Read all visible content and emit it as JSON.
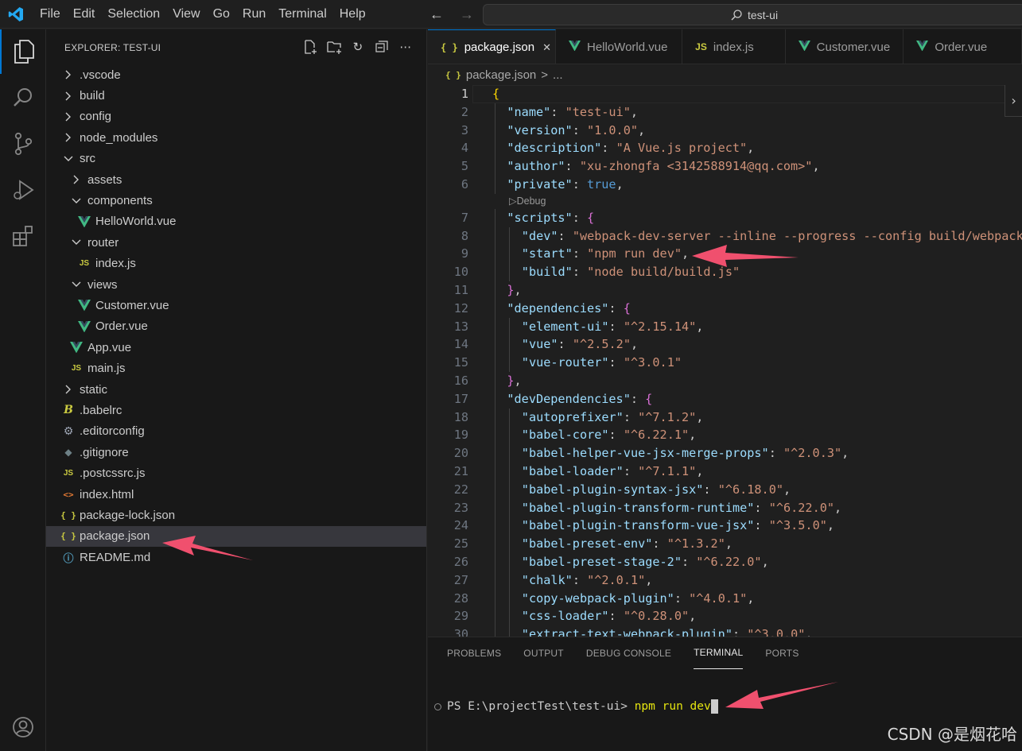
{
  "titlebar": {
    "menus": [
      "File",
      "Edit",
      "Selection",
      "View",
      "Go",
      "Run",
      "Terminal",
      "Help"
    ],
    "search_text": "test-ui"
  },
  "sidebar": {
    "title": "EXPLORER: TEST-UI",
    "items": [
      {
        "label": ".vscode",
        "type": "folder",
        "expanded": false,
        "depth": 0
      },
      {
        "label": "build",
        "type": "folder",
        "expanded": false,
        "depth": 0
      },
      {
        "label": "config",
        "type": "folder",
        "expanded": false,
        "depth": 0
      },
      {
        "label": "node_modules",
        "type": "folder",
        "expanded": false,
        "depth": 0
      },
      {
        "label": "src",
        "type": "folder",
        "expanded": true,
        "depth": 0
      },
      {
        "label": "assets",
        "type": "folder",
        "expanded": false,
        "depth": 1
      },
      {
        "label": "components",
        "type": "folder",
        "expanded": true,
        "depth": 1
      },
      {
        "label": "HelloWorld.vue",
        "type": "vue",
        "depth": 2
      },
      {
        "label": "router",
        "type": "folder",
        "expanded": true,
        "depth": 1
      },
      {
        "label": "index.js",
        "type": "js",
        "depth": 2
      },
      {
        "label": "views",
        "type": "folder",
        "expanded": true,
        "depth": 1
      },
      {
        "label": "Customer.vue",
        "type": "vue",
        "depth": 2
      },
      {
        "label": "Order.vue",
        "type": "vue",
        "depth": 2
      },
      {
        "label": "App.vue",
        "type": "vue",
        "depth": 1
      },
      {
        "label": "main.js",
        "type": "js",
        "depth": 1
      },
      {
        "label": "static",
        "type": "folder",
        "expanded": false,
        "depth": 0
      },
      {
        "label": ".babelrc",
        "type": "babel",
        "depth": 0
      },
      {
        "label": ".editorconfig",
        "type": "gear",
        "depth": 0
      },
      {
        "label": ".gitignore",
        "type": "git",
        "depth": 0
      },
      {
        "label": ".postcssrc.js",
        "type": "js",
        "depth": 0
      },
      {
        "label": "index.html",
        "type": "html",
        "depth": 0
      },
      {
        "label": "package-lock.json",
        "type": "json",
        "depth": 0
      },
      {
        "label": "package.json",
        "type": "json",
        "depth": 0,
        "selected": true
      },
      {
        "label": "README.md",
        "type": "info",
        "depth": 0
      }
    ]
  },
  "tabs": [
    {
      "label": "package.json",
      "icon": "json",
      "active": true
    },
    {
      "label": "HelloWorld.vue",
      "icon": "vue"
    },
    {
      "label": "index.js",
      "icon": "js"
    },
    {
      "label": "Customer.vue",
      "icon": "vue"
    },
    {
      "label": "Order.vue",
      "icon": "vue"
    }
  ],
  "icon_glyphs": {
    "json": "{ }",
    "js": "JS",
    "html": "<>",
    "info": "ⓘ",
    "babel": "B",
    "gear": "⚙",
    "git": "◆"
  },
  "breadcrumb": {
    "file": "package.json",
    "sep": ">",
    "rest": "..."
  },
  "editor": {
    "codelens": "Debug",
    "lines": [
      {
        "n": "1",
        "ind": 0,
        "toks": [
          [
            "{",
            "b1"
          ]
        ]
      },
      {
        "n": "2",
        "ind": 1,
        "toks": [
          [
            "\"name\"",
            "k"
          ],
          [
            ": ",
            "p"
          ],
          [
            "\"test-ui\"",
            "s"
          ],
          [
            ",",
            "p"
          ]
        ]
      },
      {
        "n": "3",
        "ind": 1,
        "toks": [
          [
            "\"version\"",
            "k"
          ],
          [
            ": ",
            "p"
          ],
          [
            "\"1.0.0\"",
            "s"
          ],
          [
            ",",
            "p"
          ]
        ]
      },
      {
        "n": "4",
        "ind": 1,
        "toks": [
          [
            "\"description\"",
            "k"
          ],
          [
            ": ",
            "p"
          ],
          [
            "\"A Vue.js project\"",
            "s"
          ],
          [
            ",",
            "p"
          ]
        ]
      },
      {
        "n": "5",
        "ind": 1,
        "toks": [
          [
            "\"author\"",
            "k"
          ],
          [
            ": ",
            "p"
          ],
          [
            "\"xu-zhongfa <3142588914@qq.com>\"",
            "s"
          ],
          [
            ",",
            "p"
          ]
        ]
      },
      {
        "n": "6",
        "ind": 1,
        "toks": [
          [
            "\"private\"",
            "k"
          ],
          [
            ": ",
            "p"
          ],
          [
            "true",
            "kw"
          ],
          [
            ",",
            "p"
          ]
        ]
      },
      {
        "n": "7",
        "ind": 1,
        "toks": [
          [
            "\"scripts\"",
            "k"
          ],
          [
            ": ",
            "p"
          ],
          [
            "{",
            "b2"
          ]
        ]
      },
      {
        "n": "8",
        "ind": 2,
        "toks": [
          [
            "\"dev\"",
            "k"
          ],
          [
            ": ",
            "p"
          ],
          [
            "\"webpack-dev-server --inline --progress --config build/webpack.dev.conf.js\"",
            "s"
          ],
          [
            ",",
            "p"
          ]
        ]
      },
      {
        "n": "9",
        "ind": 2,
        "toks": [
          [
            "\"start\"",
            "k"
          ],
          [
            ": ",
            "p"
          ],
          [
            "\"npm run dev\"",
            "s"
          ],
          [
            ",",
            "p"
          ]
        ]
      },
      {
        "n": "10",
        "ind": 2,
        "toks": [
          [
            "\"build\"",
            "k"
          ],
          [
            ": ",
            "p"
          ],
          [
            "\"node build/build.js\"",
            "s"
          ]
        ]
      },
      {
        "n": "11",
        "ind": 1,
        "toks": [
          [
            "}",
            "b2"
          ],
          [
            ",",
            "p"
          ]
        ]
      },
      {
        "n": "12",
        "ind": 1,
        "toks": [
          [
            "\"dependencies\"",
            "k"
          ],
          [
            ": ",
            "p"
          ],
          [
            "{",
            "b2"
          ]
        ]
      },
      {
        "n": "13",
        "ind": 2,
        "toks": [
          [
            "\"element-ui\"",
            "k"
          ],
          [
            ": ",
            "p"
          ],
          [
            "\"^2.15.14\"",
            "s"
          ],
          [
            ",",
            "p"
          ]
        ]
      },
      {
        "n": "14",
        "ind": 2,
        "toks": [
          [
            "\"vue\"",
            "k"
          ],
          [
            ": ",
            "p"
          ],
          [
            "\"^2.5.2\"",
            "s"
          ],
          [
            ",",
            "p"
          ]
        ]
      },
      {
        "n": "15",
        "ind": 2,
        "toks": [
          [
            "\"vue-router\"",
            "k"
          ],
          [
            ": ",
            "p"
          ],
          [
            "\"^3.0.1\"",
            "s"
          ]
        ]
      },
      {
        "n": "16",
        "ind": 1,
        "toks": [
          [
            "}",
            "b2"
          ],
          [
            ",",
            "p"
          ]
        ]
      },
      {
        "n": "17",
        "ind": 1,
        "toks": [
          [
            "\"devDependencies\"",
            "k"
          ],
          [
            ": ",
            "p"
          ],
          [
            "{",
            "b2"
          ]
        ]
      },
      {
        "n": "18",
        "ind": 2,
        "toks": [
          [
            "\"autoprefixer\"",
            "k"
          ],
          [
            ": ",
            "p"
          ],
          [
            "\"^7.1.2\"",
            "s"
          ],
          [
            ",",
            "p"
          ]
        ]
      },
      {
        "n": "19",
        "ind": 2,
        "toks": [
          [
            "\"babel-core\"",
            "k"
          ],
          [
            ": ",
            "p"
          ],
          [
            "\"^6.22.1\"",
            "s"
          ],
          [
            ",",
            "p"
          ]
        ]
      },
      {
        "n": "20",
        "ind": 2,
        "toks": [
          [
            "\"babel-helper-vue-jsx-merge-props\"",
            "k"
          ],
          [
            ": ",
            "p"
          ],
          [
            "\"^2.0.3\"",
            "s"
          ],
          [
            ",",
            "p"
          ]
        ]
      },
      {
        "n": "21",
        "ind": 2,
        "toks": [
          [
            "\"babel-loader\"",
            "k"
          ],
          [
            ": ",
            "p"
          ],
          [
            "\"^7.1.1\"",
            "s"
          ],
          [
            ",",
            "p"
          ]
        ]
      },
      {
        "n": "22",
        "ind": 2,
        "toks": [
          [
            "\"babel-plugin-syntax-jsx\"",
            "k"
          ],
          [
            ": ",
            "p"
          ],
          [
            "\"^6.18.0\"",
            "s"
          ],
          [
            ",",
            "p"
          ]
        ]
      },
      {
        "n": "23",
        "ind": 2,
        "toks": [
          [
            "\"babel-plugin-transform-runtime\"",
            "k"
          ],
          [
            ": ",
            "p"
          ],
          [
            "\"^6.22.0\"",
            "s"
          ],
          [
            ",",
            "p"
          ]
        ]
      },
      {
        "n": "24",
        "ind": 2,
        "toks": [
          [
            "\"babel-plugin-transform-vue-jsx\"",
            "k"
          ],
          [
            ": ",
            "p"
          ],
          [
            "\"^3.5.0\"",
            "s"
          ],
          [
            ",",
            "p"
          ]
        ]
      },
      {
        "n": "25",
        "ind": 2,
        "toks": [
          [
            "\"babel-preset-env\"",
            "k"
          ],
          [
            ": ",
            "p"
          ],
          [
            "\"^1.3.2\"",
            "s"
          ],
          [
            ",",
            "p"
          ]
        ]
      },
      {
        "n": "26",
        "ind": 2,
        "toks": [
          [
            "\"babel-preset-stage-2\"",
            "k"
          ],
          [
            ": ",
            "p"
          ],
          [
            "\"^6.22.0\"",
            "s"
          ],
          [
            ",",
            "p"
          ]
        ]
      },
      {
        "n": "27",
        "ind": 2,
        "toks": [
          [
            "\"chalk\"",
            "k"
          ],
          [
            ": ",
            "p"
          ],
          [
            "\"^2.0.1\"",
            "s"
          ],
          [
            ",",
            "p"
          ]
        ]
      },
      {
        "n": "28",
        "ind": 2,
        "toks": [
          [
            "\"copy-webpack-plugin\"",
            "k"
          ],
          [
            ": ",
            "p"
          ],
          [
            "\"^4.0.1\"",
            "s"
          ],
          [
            ",",
            "p"
          ]
        ]
      },
      {
        "n": "29",
        "ind": 2,
        "toks": [
          [
            "\"css-loader\"",
            "k"
          ],
          [
            ": ",
            "p"
          ],
          [
            "\"^0.28.0\"",
            "s"
          ],
          [
            ",",
            "p"
          ]
        ]
      },
      {
        "n": "30",
        "ind": 2,
        "toks": [
          [
            "\"extract-text-webpack-plugin\"",
            "k"
          ],
          [
            ": ",
            "p"
          ],
          [
            "\"^3.0.0\"",
            "s"
          ],
          [
            ",",
            "p"
          ]
        ]
      }
    ]
  },
  "panel": {
    "tabs": [
      "PROBLEMS",
      "OUTPUT",
      "DEBUG CONSOLE",
      "TERMINAL",
      "PORTS"
    ],
    "active_tab": "TERMINAL",
    "prompt": "PS E:\\projectTest\\test-ui> ",
    "command": "npm run dev"
  },
  "watermark": "CSDN @是烟花哈",
  "colors": {
    "accent": "#0078d4",
    "vue": "#41b883",
    "annotation_arrow": "#f0506e"
  }
}
